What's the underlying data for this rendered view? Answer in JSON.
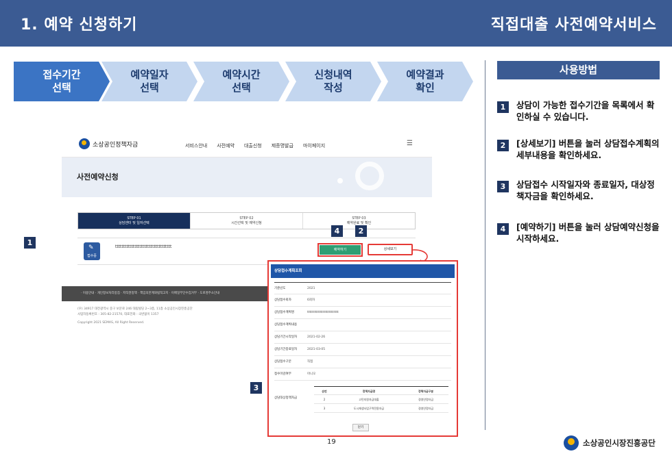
{
  "header": {
    "title_left": "1. 예약 신청하기",
    "title_right": "직접대출 사전예약서비스"
  },
  "steps": [
    {
      "line1": "접수기간",
      "line2": "선택"
    },
    {
      "line1": "예약일자",
      "line2": "선택"
    },
    {
      "line1": "예약시간",
      "line2": "선택"
    },
    {
      "line1": "신청내역",
      "line2": "작성"
    },
    {
      "line1": "예약결과",
      "line2": "확인"
    }
  ],
  "colors": {
    "header_bg": "#3b5b93",
    "step_active": "#3b74c4",
    "step_inactive": "#c3d6ef",
    "highlight": "#e53935"
  },
  "sidebar": {
    "title": "사용방법",
    "tips": [
      {
        "num": "1",
        "text": "상담이 가능한 접수기간을 목록에서 확인하실 수 있습니다."
      },
      {
        "num": "2",
        "text": "[상세보기] 버튼을 눌러 상담접수계획의 세부내용을 확인하세요."
      },
      {
        "num": "3",
        "text": "상담접수 시작일자와 종료일자, 대상정책자금을 확인하세요."
      },
      {
        "num": "4",
        "text": "[예약하기] 버튼을 눌러 상담예약신청을 시작하세요."
      }
    ]
  },
  "mock": {
    "logo": "소상공인정책자금",
    "menu": [
      "서비스안내",
      "사전예약",
      "대출신청",
      "제증명발급",
      "마이페이지"
    ],
    "hero_title": "사전예약신청",
    "tabs": [
      {
        "step": "STEP 01",
        "label": "상담센터 및 일자선택"
      },
      {
        "step": "STEP 02",
        "label": "시간선택 및 예약신청"
      },
      {
        "step": "STEP 03",
        "label": "예약완료 및 확인"
      }
    ],
    "row": {
      "badge": "접수중",
      "name": "ttttttttttttttttttttttttttttttttttt"
    },
    "reserve_button": "예약하기",
    "detail_button": "상세보기",
    "footer_links": "· 이용안내  · 개인정보처리방침  · 저작권정책  · 책임의한계와법적고지  · 이메일무단수집거부  · 도로명주소안내",
    "footer_lines": [
      "(우) 34917 대전광역시 중구 보문로 246 대림빌딩 2~3층, 11층 소상공인시장진흥공단",
      "사업자등록번호 : 305-82-21570, 대표전화 : 국번없이 1357",
      "Copyright 2021 SEMAS, All Right Reserved."
    ]
  },
  "markers": {
    "m1": "1",
    "m2": "2",
    "m3": "3",
    "m4": "4"
  },
  "popup": {
    "title": "상담접수계획조회",
    "rows": [
      {
        "key": "기준년도",
        "value": "2021"
      },
      {
        "key": "상담접수회차",
        "value": "6회차"
      },
      {
        "key": "상담접수계획명",
        "value": "tttttttttttttttttttttttttt"
      },
      {
        "key": "상담접수계획내용",
        "value": ""
      },
      {
        "key": "상담기간시작일자",
        "value": "2021-02-26"
      },
      {
        "key": "상담기간종료일자",
        "value": "2021-03-05"
      },
      {
        "key": "상담접수구분",
        "value": "직접"
      },
      {
        "key": "접수마감여부",
        "value": "아니오"
      }
    ],
    "fund_label": "상담대상정책자금",
    "table_headers": [
      "순번",
      "정책자금명",
      "정책자금구분"
    ],
    "table_rows": [
      [
        "2",
        "고민지원자금대출",
        "경영안정자금"
      ],
      [
        "3",
        "도시재생사업구역전용자금",
        "경영안정자금"
      ]
    ],
    "close_button": "닫기"
  },
  "page_number": "19",
  "brand": "소상공인시장진흥공단"
}
